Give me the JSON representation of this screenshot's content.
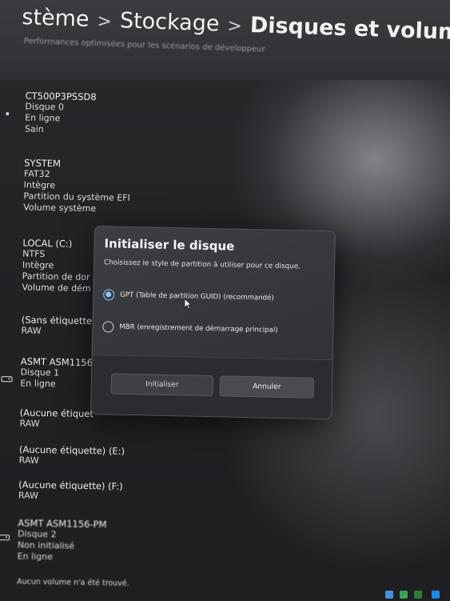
{
  "header": {
    "crumb1": "stème",
    "sep1": ">",
    "crumb2": "Stockage",
    "sep2": ">",
    "crumb3": "Disques et volumes",
    "subtitle": "Performances optimisées pour les scénarios de développeur"
  },
  "disks": [
    {
      "name": "CT500P3PSSD8",
      "lines": [
        "Disque 0",
        "En ligne",
        "Sain"
      ]
    },
    {
      "name": "ASMT ASM1156",
      "lines": [
        "Disque 1",
        "En ligne"
      ]
    },
    {
      "name": "ASMT ASM1156-PM",
      "lines": [
        "Disque 2",
        "Non initialisé",
        "En ligne"
      ]
    }
  ],
  "volumes": [
    {
      "name": "SYSTEM",
      "lines": [
        "FAT32",
        "Intègre",
        "Partition du système EFI",
        "Volume système"
      ]
    },
    {
      "name": "LOCAL (C:)",
      "lines": [
        "NTFS",
        "Intègre",
        "Partition de dor",
        "Volume de dém"
      ]
    },
    {
      "name": "(Sans étiquette)",
      "lines": [
        "RAW"
      ]
    },
    {
      "name": "(Aucune étiquet",
      "lines": [
        "RAW"
      ]
    },
    {
      "name": "(Aucune étiquette) (E:)",
      "lines": [
        "RAW"
      ]
    },
    {
      "name": "(Aucune étiquette) (F:)",
      "lines": [
        "RAW"
      ]
    }
  ],
  "empty_message": "Aucun volume n'a été trouvé.",
  "dialog": {
    "title": "Initialiser le disque",
    "description": "Choisissez le style de partition à utiliser pour ce disque.",
    "options": [
      {
        "label": "GPT (Table de partition GUID) (recommandé)",
        "selected": true
      },
      {
        "label": "MBR (enregistrement de démarrage principal)",
        "selected": false
      }
    ],
    "initialize_label": "Initialiser",
    "cancel_label": "Annuler"
  },
  "colors": {
    "accent": "#8ec8ff",
    "dialog_bg": "#37383d",
    "page_bg": "#232326"
  },
  "icons": {
    "disk": "drive-icon",
    "cursor": "mouse-pointer-icon"
  }
}
